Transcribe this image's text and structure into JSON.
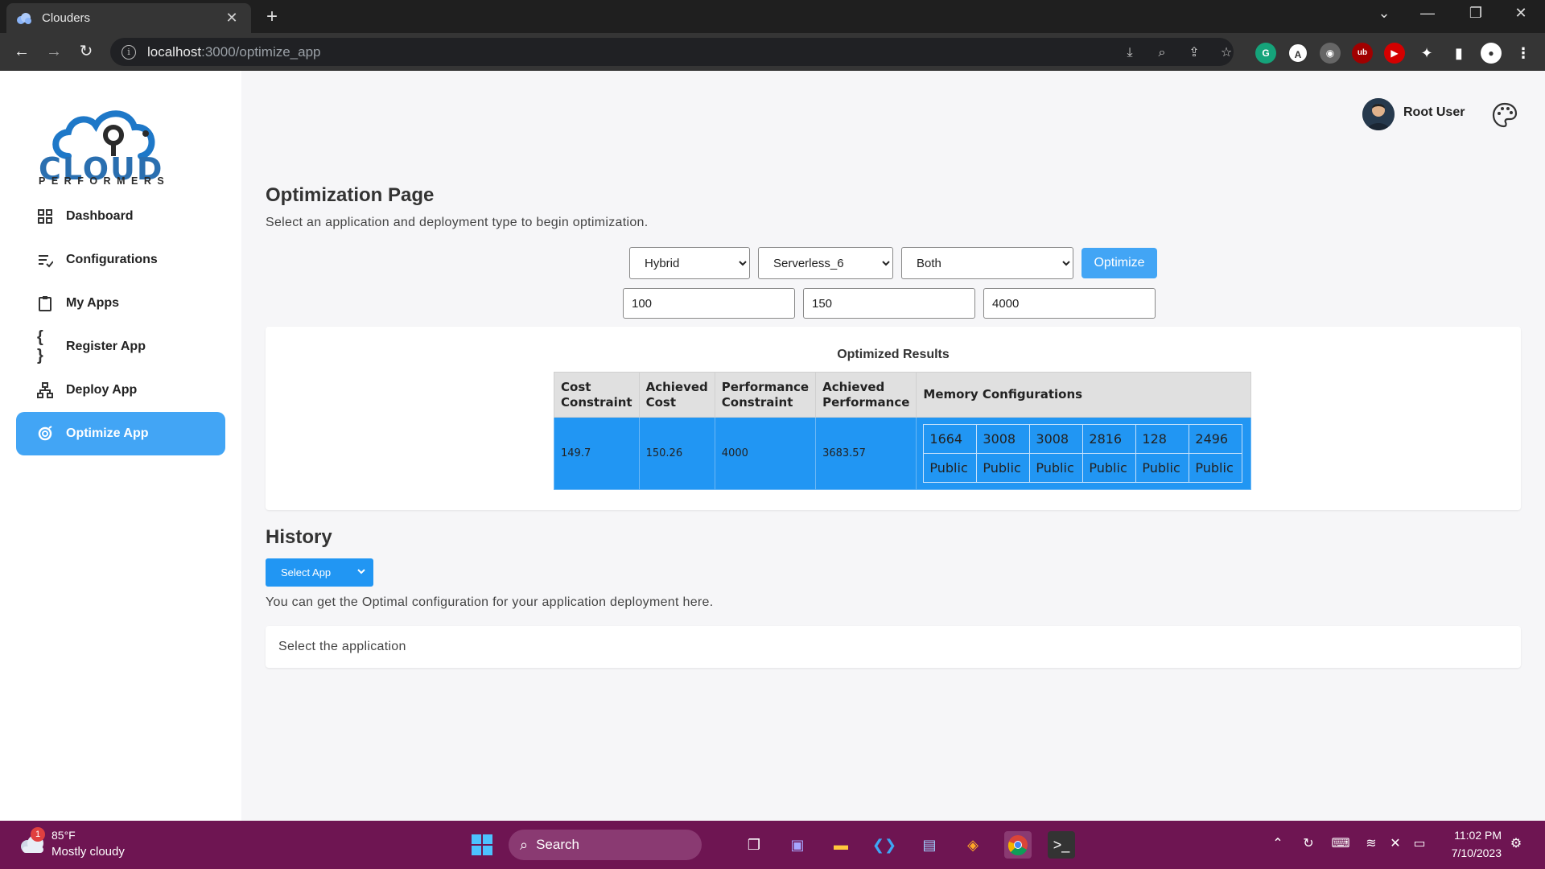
{
  "browser": {
    "tab_title": "Clouders",
    "url_host": "localhost",
    "url_path": ":3000/optimize_app"
  },
  "sidebar": {
    "logo_word": "CLOUD",
    "logo_sub": "PERFORMERS",
    "items": [
      {
        "label": "Dashboard",
        "icon": "dashboard-icon",
        "active": false
      },
      {
        "label": "Configurations",
        "icon": "configurations-icon",
        "active": false
      },
      {
        "label": "My Apps",
        "icon": "clipboard-icon",
        "active": false
      },
      {
        "label": "Register App",
        "icon": "braces-icon",
        "active": false
      },
      {
        "label": "Deploy App",
        "icon": "hierarchy-icon",
        "active": false
      },
      {
        "label": "Optimize App",
        "icon": "optimize-icon",
        "active": true
      }
    ]
  },
  "header": {
    "user_name": "Root User"
  },
  "main": {
    "title": "Optimization Page",
    "subtitle": "Select an application and deployment type to begin optimization.",
    "selects": {
      "deployment": "Hybrid",
      "app": "Serverless_6",
      "mode": "Both"
    },
    "optimize_label": "Optimize",
    "inputs": {
      "cost": "100",
      "cost2": "150",
      "performance": "4000"
    },
    "results": {
      "title": "Optimized Results",
      "headers": [
        "Cost Constraint",
        "Achieved Cost",
        "Performance Constraint",
        "Achieved Performance",
        "Memory Configurations"
      ],
      "row": {
        "cost_constraint": "149.7",
        "achieved_cost": "150.26",
        "performance_constraint": "4000",
        "achieved_performance": "3683.57"
      },
      "memory": [
        "1664",
        "3008",
        "3008",
        "2816",
        "128",
        "2496"
      ],
      "memory_type": [
        "Public",
        "Public",
        "Public",
        "Public",
        "Public",
        "Public"
      ]
    }
  },
  "history": {
    "title": "History",
    "select_label": "Select App",
    "subtitle": "You can get the Optimal configuration for your application deployment here.",
    "placeholder": "Select the application"
  },
  "taskbar": {
    "weather_temp": "85°F",
    "weather_desc": "Mostly cloudy",
    "weather_badge": "1",
    "search_label": "Search",
    "time": "11:02 PM",
    "date": "7/10/2023"
  },
  "colors": {
    "accent": "#42a5f5",
    "table_row": "#2196f3",
    "taskbar": "#6e1552"
  }
}
